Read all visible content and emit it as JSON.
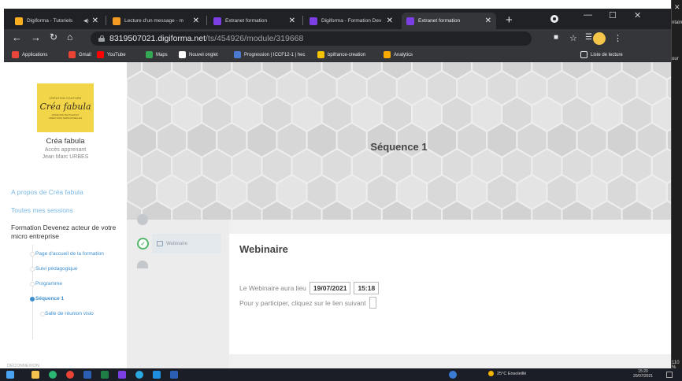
{
  "browser": {
    "tabs": [
      {
        "title": "Digiforma - Tutoriels",
        "icon": "digiforma-icon",
        "color": "#ffb020",
        "extra": "audio-icon"
      },
      {
        "title": "Lecture d'un message - m",
        "icon": "mail-icon",
        "color": "#f59a23"
      },
      {
        "title": "Extranet formation",
        "icon": "digiforma-icon",
        "color": "#7b3fe4"
      },
      {
        "title": "Digiforma - Formation Dev",
        "icon": "digiforma-icon",
        "color": "#7b3fe4"
      },
      {
        "title": "Extranet formation",
        "icon": "digiforma-icon",
        "color": "#7b3fe4",
        "active": true
      }
    ],
    "new_tab": "+",
    "url_host": "8319507021.digiforma.net",
    "url_path": "/ts/454926/module/319668",
    "bookmarks": [
      {
        "label": "Applications",
        "color": "#e8453c"
      },
      {
        "label": "Gmail",
        "color": "#ea4335"
      },
      {
        "label": "YouTube",
        "color": "#ff0000"
      },
      {
        "label": "Maps",
        "color": "#34a853"
      },
      {
        "label": "Nouvel onglet",
        "color": "#ffffff"
      },
      {
        "label": "Progression | ICCF12-1 | hec",
        "color": "#4a7bd0"
      },
      {
        "label": "bpifrance-creation",
        "color": "#f5c400"
      },
      {
        "label": "Analytics",
        "color": "#f9ab00"
      }
    ],
    "reading_list": "Liste de lecture"
  },
  "sidebar": {
    "logo": {
      "line1": "CRÉATION COUTURE",
      "line2": "Créa fabula",
      "line3": "PASSIONS TEXTILES ET CRÉATIONS PERSONNELLES"
    },
    "org_name": "Créa fabula",
    "role": "Accès apprenant",
    "user": "Jean Marc URBES",
    "about_link": "A propos de  Créa fabula",
    "sessions_link": "Toutes mes sessions",
    "formation_title": "Formation Devenez acteur de votre micro entreprise",
    "tree": [
      {
        "label": "Page d'accueil de la formation"
      },
      {
        "label": "Suivi pédagogique"
      },
      {
        "label": "Programme"
      },
      {
        "label": "Séquence 1",
        "current": true
      },
      {
        "label": "Salle de réunion visio",
        "sub": true
      }
    ],
    "logout": "DÉCONNEXION"
  },
  "main": {
    "banner_title": "Séquence 1",
    "lane_item": "Webinaire",
    "card": {
      "title": "Webinaire",
      "line1_text": "Le Webinaire aura lieu",
      "date": "19/07/2021",
      "time": "15:18",
      "line2_text": "Pour y participer, cliquez sur le lien suivant"
    }
  },
  "taskbar": {
    "weather": "25°C  Ensoleillé",
    "time": "15:20",
    "date": "20/07/2021"
  },
  "background_window": {
    "title_fragment": "ntaires",
    "fragment2": "our",
    "zoom": "110 %"
  }
}
